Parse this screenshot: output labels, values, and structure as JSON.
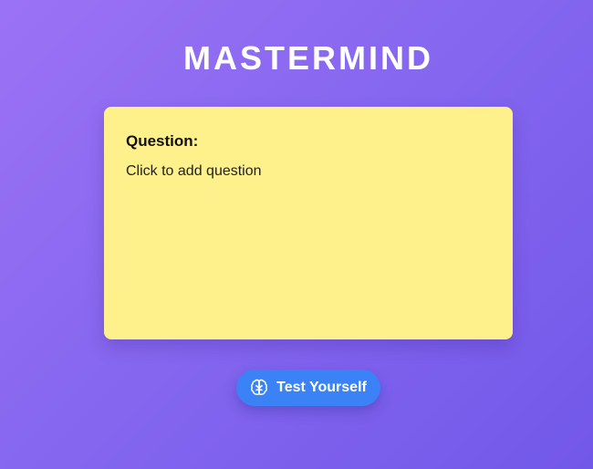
{
  "app": {
    "title": "MASTERMIND"
  },
  "card": {
    "heading": "Question:",
    "placeholder_text": "Click to add question",
    "background_color": "#fef08a"
  },
  "action": {
    "test_button_label": "Test Yourself",
    "test_button_icon": "brain-icon",
    "button_color": "#3b82f6"
  },
  "theme": {
    "background_gradient_start": "#9b72f5",
    "background_gradient_end": "#7258e9"
  }
}
